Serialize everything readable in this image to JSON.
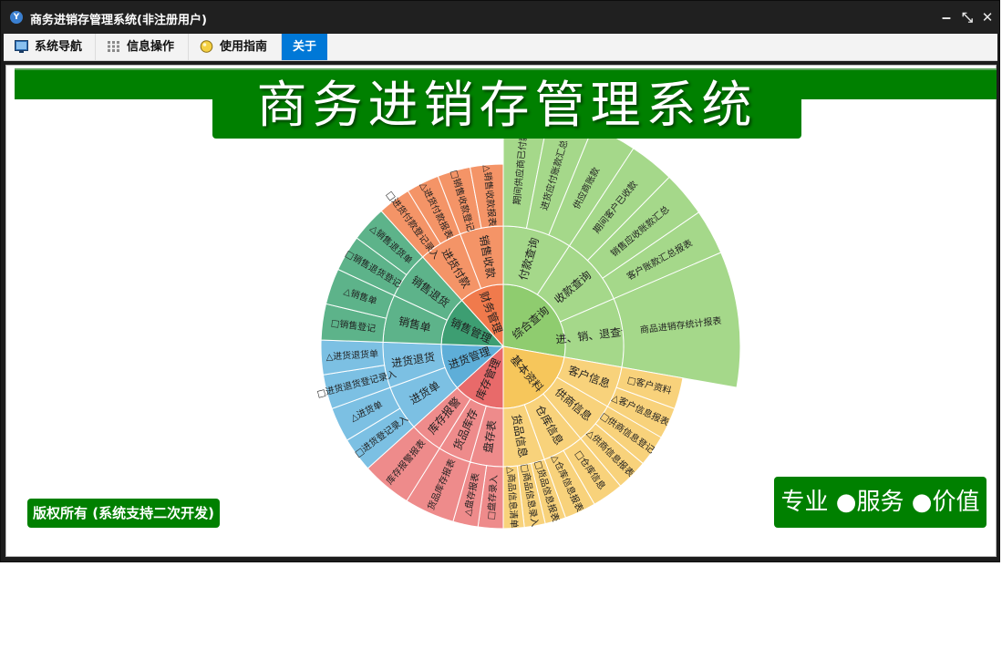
{
  "window": {
    "title": "商务进销存管理系统(非注册用户)",
    "app_icon": "Y"
  },
  "menu": {
    "tabs": [
      {
        "label": "系统导航",
        "icon": "monitor-icon"
      },
      {
        "label": "信息操作",
        "icon": "grid-icon"
      },
      {
        "label": "使用指南",
        "icon": "lightbulb-icon"
      },
      {
        "label": "关于",
        "icon": ""
      }
    ]
  },
  "banner": {
    "title": "商务进销存管理系统"
  },
  "footer": {
    "copyright": "版权所有 (系统支持二次开发)",
    "tagline": "专业 ●服务 ●价值"
  },
  "sunburst": {
    "segments": [
      {
        "name": "综合查询",
        "color": "#8fcc6f",
        "children": [
          {
            "name": "付款查询",
            "color": "#a5d88a",
            "leaves": [
              "期间供应商已付款",
              "进货应付账款汇总",
              "供应商账款"
            ]
          },
          {
            "name": "收款查询",
            "color": "#a5d88a",
            "leaves": [
              "期间客户已收款",
              "销售应收账款汇总",
              "客户账款汇总报表"
            ]
          },
          {
            "name": "进、销、退查询",
            "color": "#a5d88a",
            "leaves": [
              "商品进销存统计报表"
            ]
          }
        ]
      },
      {
        "name": "基本资料",
        "color": "#f6c65b",
        "children": [
          {
            "name": "客户信息",
            "color": "#f8d27b",
            "leaves": [
              "□客户资料",
              "△客户信息报表"
            ]
          },
          {
            "name": "供商信息",
            "color": "#f8d27b",
            "leaves": [
              "□供商信息登记",
              "△供商信息报表"
            ]
          },
          {
            "name": "仓库信息",
            "color": "#f8d27b",
            "leaves": [
              "□仓库信息",
              "△仓库信息报表"
            ]
          },
          {
            "name": "货品信息",
            "color": "#f8d27b",
            "leaves": [
              "□货品信息报表",
              "□商品信息录入",
              "△商品信息清单"
            ]
          }
        ]
      },
      {
        "name": "库存管理",
        "color": "#e86a6a",
        "children": [
          {
            "name": "盘存表",
            "color": "#ee8b8b",
            "leaves": [
              "□盘存录入",
              "△盘存报表"
            ]
          },
          {
            "name": "货品库存",
            "color": "#ee8b8b",
            "leaves": [
              "货品库存报表"
            ]
          },
          {
            "name": "库存报警",
            "color": "#ee8b8b",
            "leaves": [
              "库存报警报表"
            ]
          }
        ]
      },
      {
        "name": "进货管理",
        "color": "#5eaed8",
        "children": [
          {
            "name": "进货单",
            "color": "#7cc0e3",
            "leaves": [
              "□进货登记录入",
              "△进货单"
            ]
          },
          {
            "name": "进货退货",
            "color": "#7cc0e3",
            "leaves": [
              "□进货退货登记录入",
              "△进货退货单"
            ]
          }
        ]
      },
      {
        "name": "销售管理",
        "color": "#3d9e72",
        "children": [
          {
            "name": "销售单",
            "color": "#5db38a",
            "leaves": [
              "□销售登记",
              "△销售单"
            ]
          },
          {
            "name": "销售退货",
            "color": "#5db38a",
            "leaves": [
              "□销售退货登记",
              "△销售退货单"
            ]
          }
        ]
      },
      {
        "name": "财务管理",
        "color": "#f07a4c",
        "children": [
          {
            "name": "进货付款",
            "color": "#f49467",
            "leaves": [
              "□进货付款登记录入",
              "△进货付款报表"
            ]
          },
          {
            "name": "销售收款",
            "color": "#f49467",
            "leaves": [
              "□销售收款登记",
              "△销售收款报表"
            ]
          }
        ]
      }
    ]
  }
}
